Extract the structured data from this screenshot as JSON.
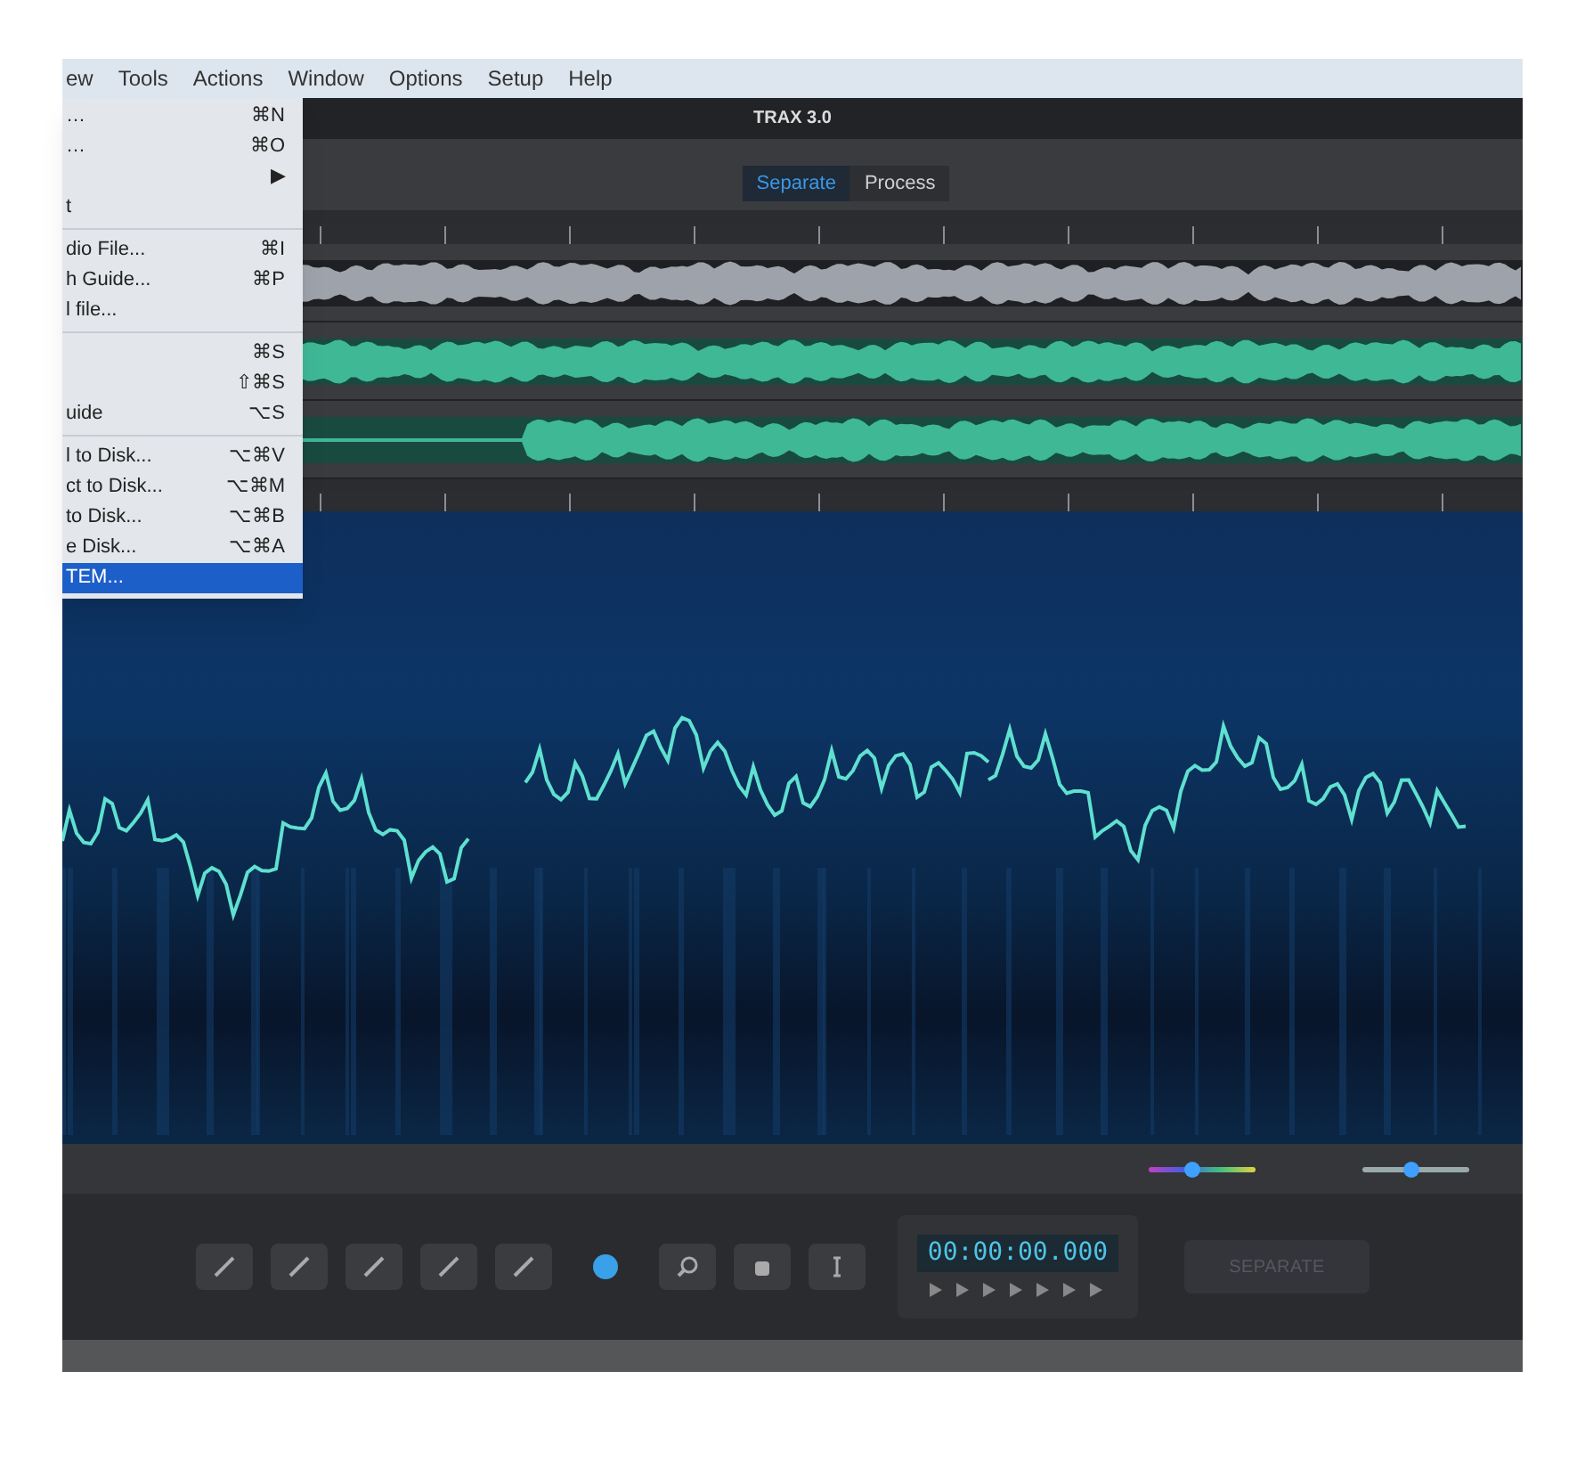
{
  "menubar": {
    "items": [
      "ew",
      "Tools",
      "Actions",
      "Window",
      "Options",
      "Setup",
      "Help"
    ]
  },
  "menu": {
    "groups": [
      [
        {
          "label": "…",
          "shortcut": "⌘N",
          "selected": false
        },
        {
          "label": "…",
          "shortcut": "⌘O",
          "selected": false
        },
        {
          "shortcut": "▶",
          "selected": false
        },
        {
          "label": "t",
          "selected": false
        }
      ],
      [
        {
          "label": "dio File...",
          "shortcut": "⌘I",
          "selected": false
        },
        {
          "label": "h Guide...",
          "shortcut": "⌘P",
          "selected": false
        },
        {
          "label": "l file...",
          "selected": false
        }
      ],
      [
        {
          "shortcut": "⌘S",
          "selected": false
        },
        {
          "shortcut": "⇧⌘S",
          "selected": false
        },
        {
          "label": "uide",
          "shortcut": "⌥S",
          "selected": false
        }
      ],
      [
        {
          "label": "l to Disk...",
          "shortcut": "⌥⌘V",
          "selected": false
        },
        {
          "label": "ct to Disk...",
          "shortcut": "⌥⌘M",
          "selected": false
        },
        {
          "label": "to Disk...",
          "shortcut": "⌥⌘B",
          "selected": false
        },
        {
          "label": "e Disk...",
          "shortcut": "⌥⌘A",
          "selected": false
        },
        {
          "label": "TEM...",
          "selected": true
        }
      ]
    ]
  },
  "window": {
    "title": "TRAX 3.0"
  },
  "tabs": [
    {
      "label": "Separate",
      "selected": true
    },
    {
      "label": "Process",
      "selected": false
    }
  ],
  "tracks": [
    {
      "kind": "mix"
    },
    {
      "kind": "part"
    },
    {
      "kind": "part"
    }
  ],
  "sliders": [
    {
      "kind": "color",
      "level": 0.4
    },
    {
      "kind": "zoom",
      "level": 0.45
    }
  ],
  "toolbar": {
    "timecode": "00:00:00.000",
    "action": {
      "label": "SEPARATE",
      "disabled": true
    }
  }
}
